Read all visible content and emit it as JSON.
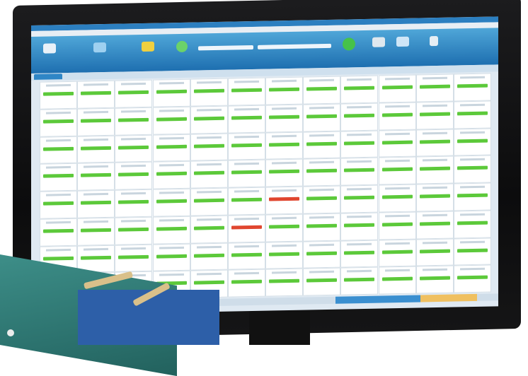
{
  "scene": {
    "subject": "",
    "screen_app": {
      "ribbon_colors": {
        "ribbon": "#1e6fb0",
        "pass": "#5cc93a",
        "fail": "#e0462f"
      },
      "ribbon_buttons": [
        {
          "icon": "folder-icon"
        },
        {
          "icon": "users-icon"
        },
        {
          "icon": "user-add-icon"
        },
        {
          "icon": "settings-icon"
        },
        {
          "icon": "play-icon"
        },
        {
          "icon": "calculator-icon"
        },
        {
          "icon": "monitor-icon"
        },
        {
          "icon": "database-icon"
        }
      ],
      "grid": {
        "rows": 8,
        "cols": 12,
        "fail_cells": [
          [
            4,
            6
          ],
          [
            5,
            5
          ]
        ]
      }
    }
  }
}
